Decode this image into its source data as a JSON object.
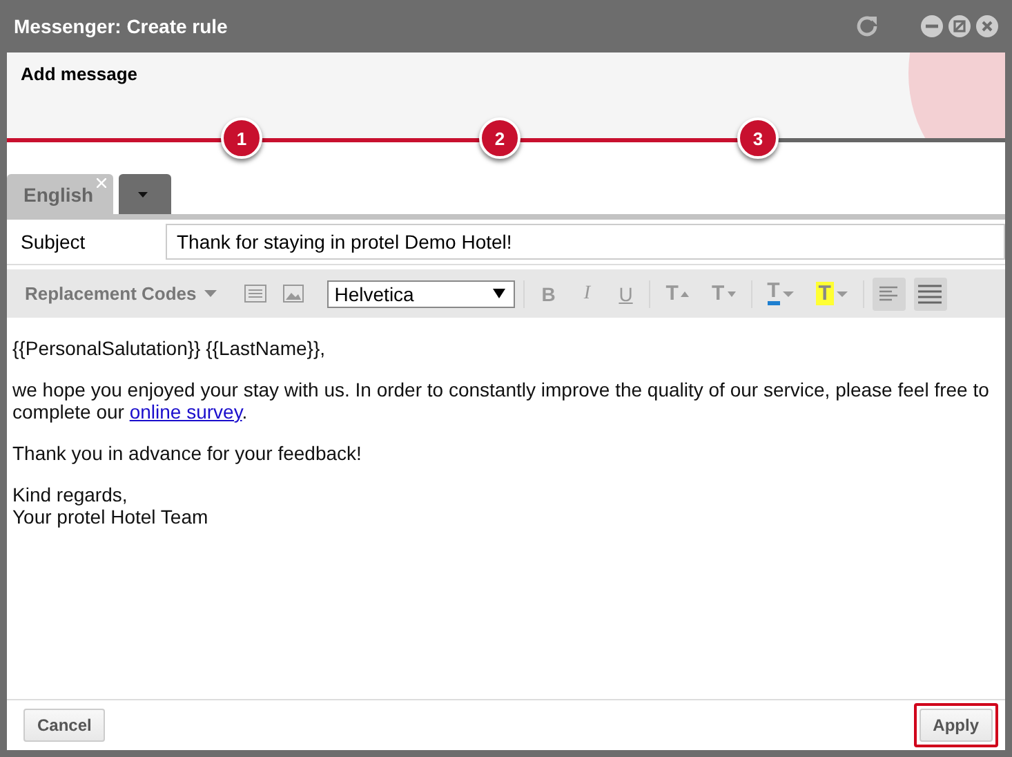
{
  "window": {
    "title": "Messenger: Create rule"
  },
  "header": {
    "title": "Add message"
  },
  "steps": [
    {
      "label": "1",
      "reached": true
    },
    {
      "label": "2",
      "reached": true
    },
    {
      "label": "3",
      "reached": true
    }
  ],
  "language_tabs": [
    {
      "label": "English",
      "kind": "language",
      "selected": true,
      "closable": true
    },
    {
      "kind": "dropdown",
      "selected": false
    }
  ],
  "subject": {
    "label": "Subject",
    "value": "Thank for staying in protel Demo Hotel!"
  },
  "toolbar": [
    {
      "kind": "menu",
      "label": "Replacement Codes"
    },
    {
      "kind": "list-icon"
    },
    {
      "kind": "image-icon"
    },
    {
      "kind": "font",
      "value": "Helvetica"
    },
    {
      "kind": "sep"
    },
    {
      "kind": "bold",
      "label": "B"
    },
    {
      "kind": "italic",
      "label": "I"
    },
    {
      "kind": "underline",
      "label": "U"
    },
    {
      "kind": "sep"
    },
    {
      "kind": "grow",
      "label": "T"
    },
    {
      "kind": "shrink",
      "label": "T"
    },
    {
      "kind": "sep"
    },
    {
      "kind": "color",
      "label": "T",
      "color": "#1e7fd0"
    },
    {
      "kind": "highlight",
      "label": "T",
      "color": "#ffff33"
    },
    {
      "kind": "sep"
    },
    {
      "kind": "align",
      "selected": true
    },
    {
      "kind": "justify",
      "selected": true
    }
  ],
  "body": [
    {
      "parts": [
        {
          "kind": "text",
          "text": "{{PersonalSalutation}} {{LastName}},"
        }
      ]
    },
    {
      "parts": [
        {
          "kind": "text",
          "text": "we hope you enjoyed your stay with us. In order to constantly improve the quality of our service, please feel free to complete our "
        },
        {
          "kind": "link",
          "text": "online survey"
        },
        {
          "kind": "text",
          "text": "."
        }
      ]
    },
    {
      "parts": [
        {
          "kind": "text",
          "text": "Thank you in advance for your feedback!"
        }
      ]
    },
    {
      "parts": [
        {
          "kind": "text",
          "text": "Kind regards,"
        },
        {
          "kind": "break"
        },
        {
          "kind": "text",
          "text": "Your protel Hotel Team"
        }
      ]
    }
  ],
  "footer": {
    "buttons": [
      {
        "label": "Cancel",
        "highlighted": false
      },
      {
        "label": "Apply",
        "highlighted": true
      }
    ]
  }
}
